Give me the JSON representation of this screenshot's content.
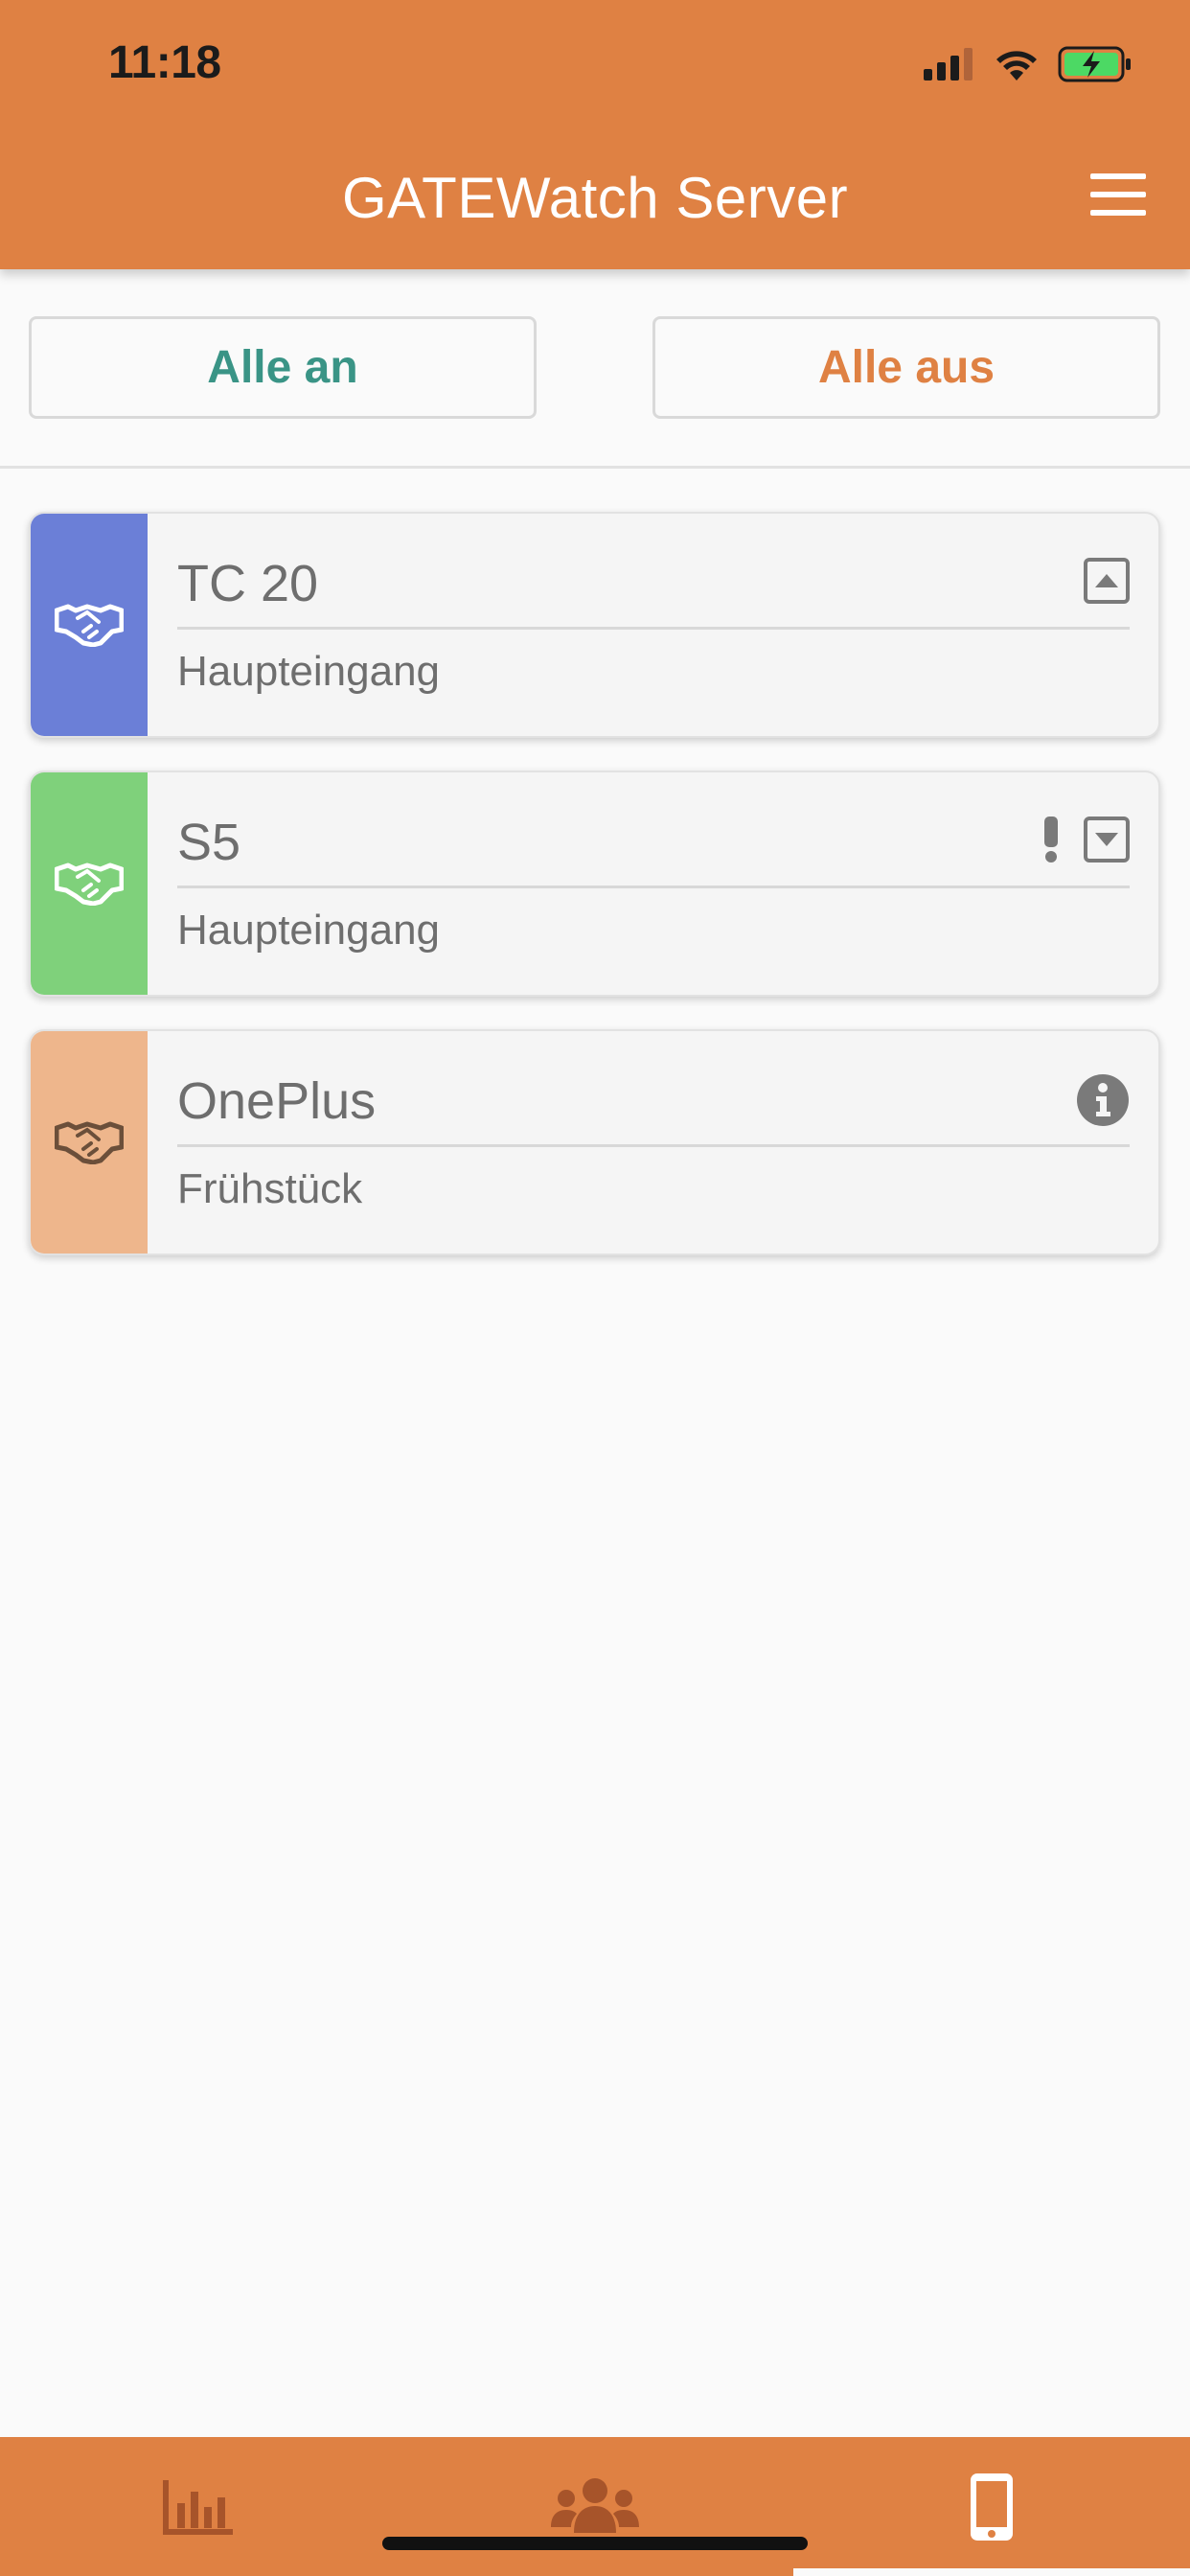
{
  "status_bar": {
    "time": "11:18",
    "signal_icon": "signal-bars-icon",
    "wifi_icon": "wifi-icon",
    "battery_icon": "battery-charging-icon",
    "battery_color": "#4cd964"
  },
  "header": {
    "title": "GATEWatch Server",
    "menu_icon": "hamburger-menu-icon",
    "background": "#df8143"
  },
  "actions": {
    "all_on_label": "Alle an",
    "all_off_label": "Alle aus"
  },
  "devices": [
    {
      "name": "TC 20",
      "location": "Haupteingang",
      "strip_color": "#6b7fd7",
      "icon_color": "#ffffff",
      "status_icons": [
        "collapse-up-icon"
      ]
    },
    {
      "name": "S5",
      "location": "Haupteingang",
      "strip_color": "#7fd17b",
      "icon_color": "#ffffff",
      "status_icons": [
        "warning-exclamation-icon",
        "expand-down-icon"
      ]
    },
    {
      "name": "OnePlus",
      "location": "Frühstück",
      "strip_color": "#eeb68c",
      "icon_color": "#6b4f3a",
      "status_icons": [
        "info-icon"
      ]
    }
  ],
  "bottom_nav": {
    "tabs": [
      {
        "icon": "bar-chart-icon",
        "active": false
      },
      {
        "icon": "users-group-icon",
        "active": false
      },
      {
        "icon": "mobile-phone-icon",
        "active": true
      }
    ]
  }
}
